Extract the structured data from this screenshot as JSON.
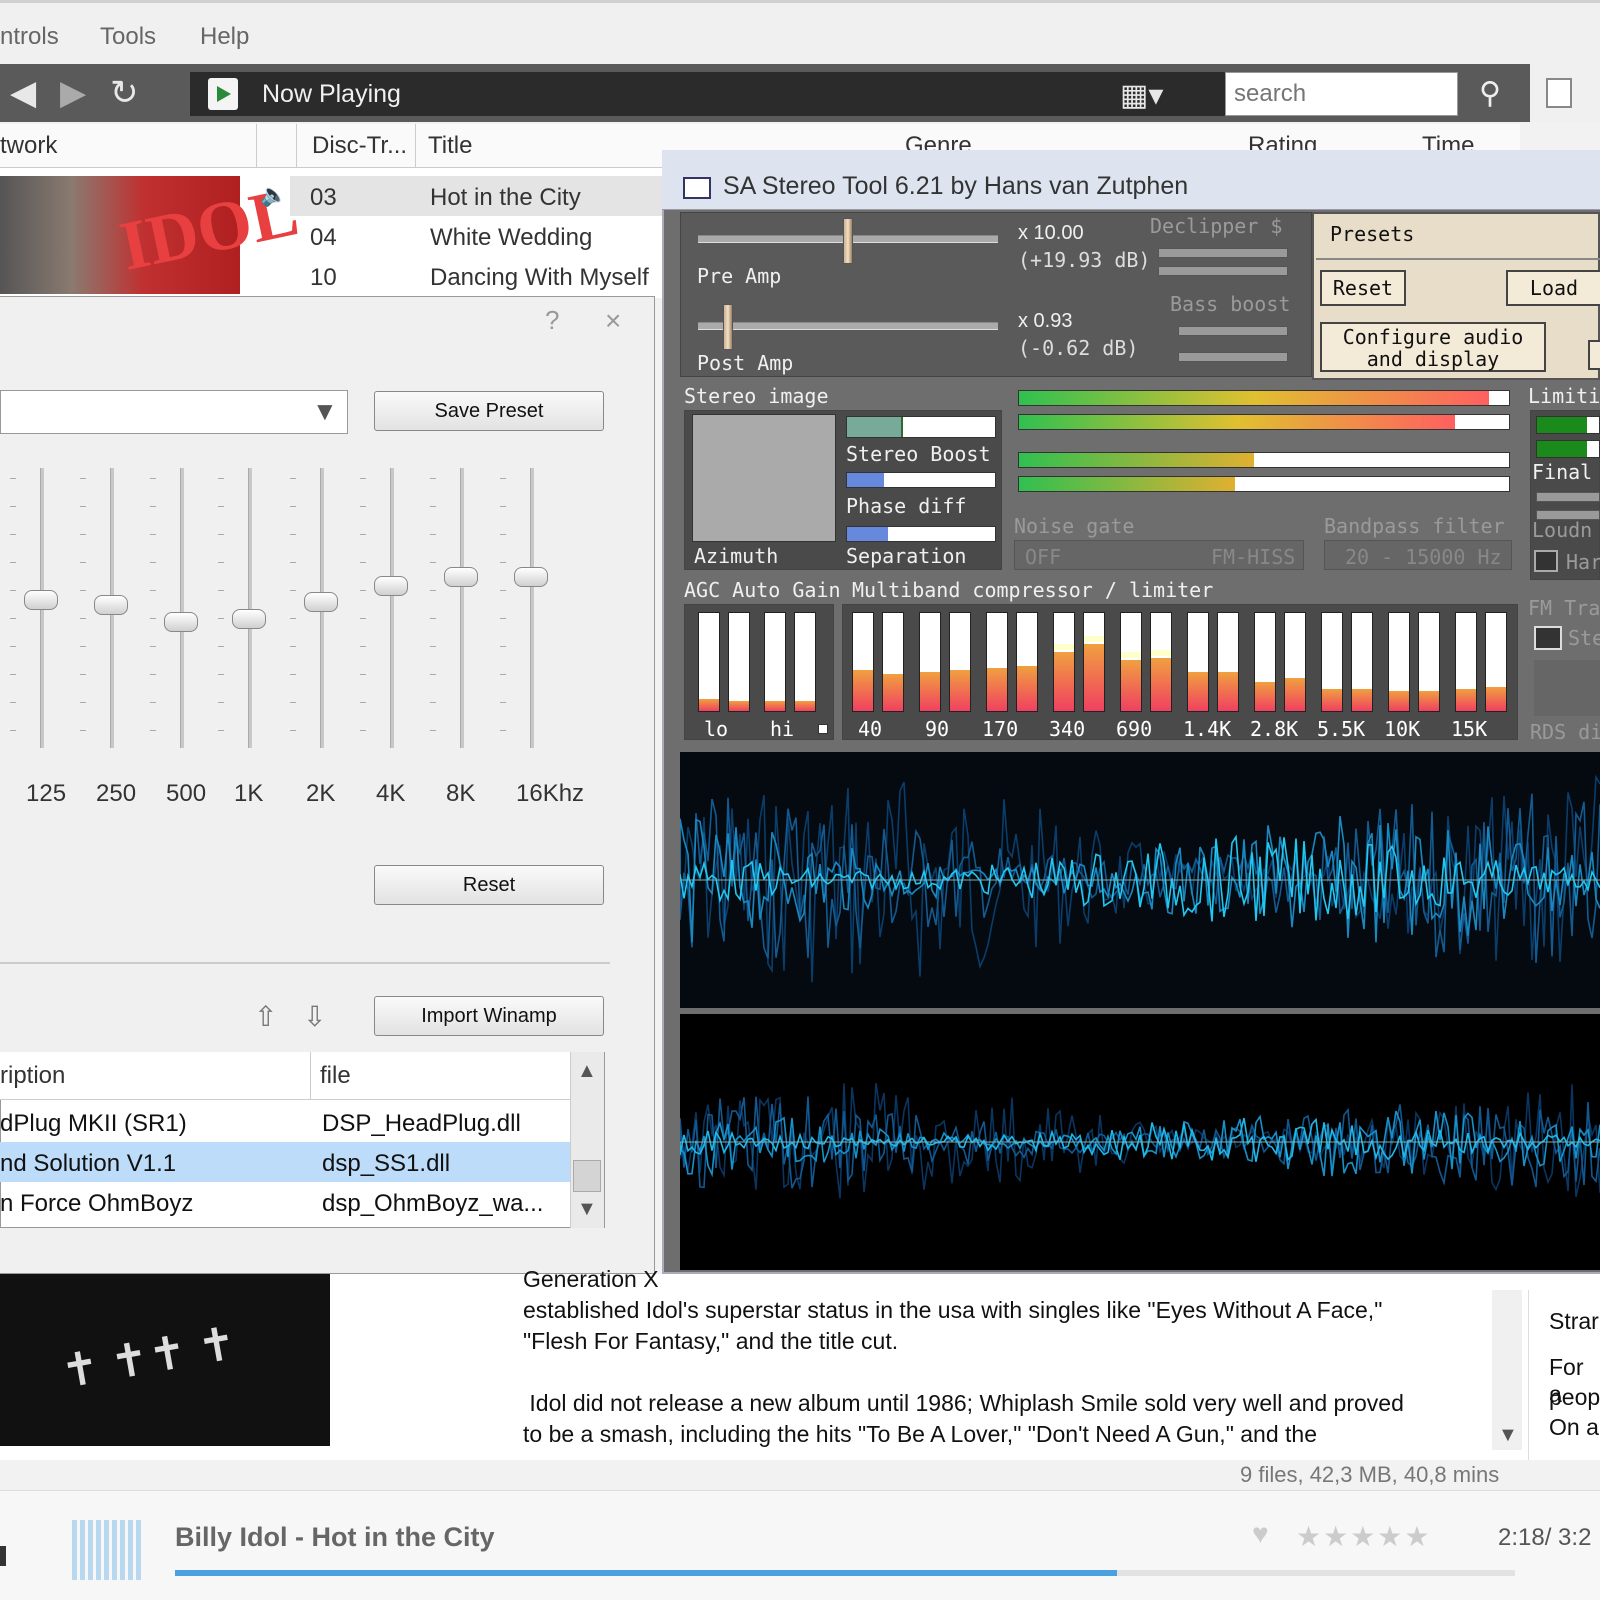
{
  "menu": {
    "items": [
      "ntrols",
      "Tools",
      "Help"
    ]
  },
  "toolbar": {
    "now_playing": "Now Playing",
    "search_placeholder": "search",
    "icons": [
      "back-arrow-icon",
      "forward-arrow-icon",
      "refresh-icon",
      "view-grid-icon",
      "search-icon"
    ]
  },
  "columns": {
    "artwork": "twork",
    "disc_track": "Disc-Tr...",
    "title": "Title",
    "genre": "Genre",
    "rating": "Rating",
    "time": "Time"
  },
  "tracks": [
    {
      "num": "03",
      "title": "Hot in the City",
      "playing": true
    },
    {
      "num": "04",
      "title": "White Wedding",
      "playing": false
    },
    {
      "num": "10",
      "title": "Dancing With Myself",
      "playing": false
    }
  ],
  "album_art_text": "IDOL",
  "equalizer": {
    "help": "?",
    "close": "×",
    "save_preset": "Save Preset",
    "reset": "Reset",
    "import_winamp": "Import Winamp",
    "bands": [
      {
        "label": "125",
        "level": 0.53
      },
      {
        "label": "250",
        "level": 0.51
      },
      {
        "label": "500",
        "level": 0.45
      },
      {
        "label": "1K",
        "level": 0.46
      },
      {
        "label": "2K",
        "level": 0.52
      },
      {
        "label": "4K",
        "level": 0.58
      },
      {
        "label": "8K",
        "level": 0.61
      },
      {
        "label": "16Khz",
        "level": 0.61
      }
    ],
    "dsp_columns": {
      "description": "ription",
      "file": "file"
    },
    "dsp_plugins": [
      {
        "description": "dPlug MKII (SR1)",
        "file": "DSP_HeadPlug.dll",
        "selected": false
      },
      {
        "description": "nd Solution V1.1",
        "file": "dsp_SS1.dll",
        "selected": true
      },
      {
        "description": "n Force OhmBoyz",
        "file": "dsp_OhmBoyz_wa...",
        "selected": false
      }
    ]
  },
  "stereo_tool": {
    "title": "SA Stereo Tool 6.21 by Hans van Zutphen",
    "pre_amp": {
      "label": "Pre Amp",
      "value": "x 10.00",
      "db": "(+19.93 dB)",
      "position": 0.5
    },
    "post_amp": {
      "label": "Post Amp",
      "value": "x 0.93",
      "db": "(-0.62 dB)",
      "position": 0.1
    },
    "declipper": "Declipper $",
    "bass_boost": "Bass boost",
    "presets": "Presets",
    "reset": "Reset",
    "load": "Load",
    "configure": [
      "Configure audio",
      "and display"
    ],
    "stereo_image": "Stereo image",
    "stereo_boost": "Stereo Boost",
    "phase_diff": "Phase diff",
    "separation": "Separation",
    "azimuth": "Azimuth",
    "stereo_boost_level": 0.38,
    "phase_diff_level": 0.25,
    "separation_level": 0.28,
    "level_meters": [
      0.96,
      0.89,
      0.48,
      0.44
    ],
    "limiter": "Limiti",
    "final": "Final",
    "loudness": "Loudn",
    "hard": "Har",
    "noise_gate": "Noise gate",
    "noise_gate_value": "OFF",
    "noise_gate_mode": "FM-HISS",
    "bandpass": "Bandpass filter",
    "bandpass_value": "20 - 15000 Hz",
    "agc": "AGC Auto Gain",
    "multiband": "Multiband compressor / limiter",
    "fm": "FM Tra",
    "stereo_short": "Ste",
    "rds": "RDS di",
    "agc_bands": [
      {
        "label": "lo",
        "levels": [
          0.12,
          0.1
        ]
      },
      {
        "label": "hi",
        "levels": [
          0.1,
          0.1
        ]
      }
    ],
    "mb_bands": [
      {
        "label": "40",
        "levels": [
          0.42,
          0.38
        ]
      },
      {
        "label": "90",
        "levels": [
          0.4,
          0.42
        ]
      },
      {
        "label": "170",
        "levels": [
          0.44,
          0.46
        ]
      },
      {
        "label": "340",
        "levels": [
          0.6,
          0.68
        ]
      },
      {
        "label": "690",
        "levels": [
          0.52,
          0.54
        ]
      },
      {
        "label": "1.4K",
        "levels": [
          0.4,
          0.4
        ]
      },
      {
        "label": "2.8K",
        "levels": [
          0.3,
          0.34
        ]
      },
      {
        "label": "5.5K",
        "levels": [
          0.22,
          0.22
        ]
      },
      {
        "label": "10K",
        "levels": [
          0.2,
          0.2
        ]
      },
      {
        "label": "15K",
        "levels": [
          0.22,
          0.24
        ]
      }
    ]
  },
  "bio": {
    "lines": [
      "Generation X",
      "established Idol's superstar status in the usa with singles like \"Eyes Without A Face,\"",
      "\"Flesh For Fantasy,\" and the title cut.",
      " Idol did not release a new album until 1986; Whiplash Smile sold very well and proved",
      "to be a smash, including the hits \"To Be A Lover,\" \"Don't Need A Gun,\" and the"
    ],
    "right_lines": [
      "Strar",
      "For a",
      "peop",
      "On a"
    ],
    "status": "9 files, 42,3 MB, 40,8 mins"
  },
  "player": {
    "artist": "Billy Idol",
    "separator": "-",
    "track": "Hot in the City",
    "stars": "★★★★★",
    "heart": "♥",
    "time": "2:18/ 3:2",
    "progress": 0.7
  }
}
